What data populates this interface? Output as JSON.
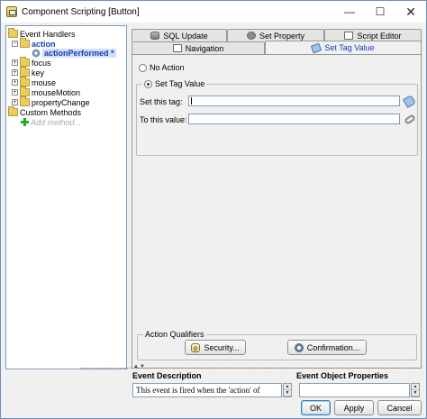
{
  "window": {
    "title": "Component Scripting [Button]",
    "minimize": "—",
    "maximize": "☐",
    "close": "✕"
  },
  "tree": {
    "event_handlers": "Event Handlers",
    "action": "action",
    "action_performed": "actionPerformed *",
    "focus": "focus",
    "key": "key",
    "mouse": "mouse",
    "mouse_motion": "mouseMotion",
    "property_change": "propertyChange",
    "custom_methods": "Custom Methods",
    "add_method": "Add method..."
  },
  "tabs": {
    "sql_update": "SQL Update",
    "set_property": "Set Property",
    "script_editor": "Script Editor",
    "navigation": "Navigation",
    "set_tag_value": "Set Tag Value"
  },
  "panel": {
    "no_action": "No Action",
    "set_tag_value": "Set Tag Value",
    "set_this_tag_label": "Set this tag:",
    "set_this_tag_value": "",
    "to_this_value_label": "To this value:",
    "to_this_value_value": "",
    "action_qualifiers": "Action Qualifiers",
    "security_button": "Security...",
    "confirmation_button": "Confirmation..."
  },
  "bottom": {
    "event_description_label": "Event Description",
    "event_description_text": "This event is fired when the 'action' of",
    "event_object_properties_label": "Event Object Properties",
    "event_object_properties_value": ""
  },
  "buttons": {
    "ok": "OK",
    "apply": "Apply",
    "cancel": "Cancel"
  }
}
